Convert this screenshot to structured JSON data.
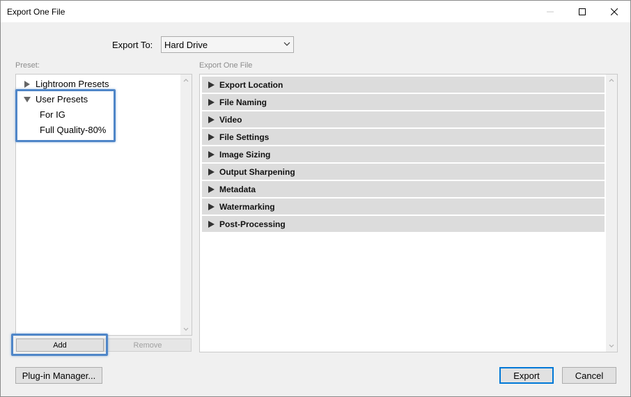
{
  "window": {
    "title": "Export One File"
  },
  "export_to": {
    "label": "Export To:",
    "selected": "Hard Drive"
  },
  "preset": {
    "title": "Preset:",
    "items": [
      {
        "label": "Lightroom Presets",
        "expanded": false
      },
      {
        "label": "User Presets",
        "expanded": true
      },
      {
        "label": "For IG"
      },
      {
        "label": "Full Quality-80%"
      }
    ],
    "add_label": "Add",
    "remove_label": "Remove"
  },
  "export_panel": {
    "title": "Export One File",
    "sections": [
      "Export Location",
      "File Naming",
      "Video",
      "File Settings",
      "Image Sizing",
      "Output Sharpening",
      "Metadata",
      "Watermarking",
      "Post-Processing"
    ]
  },
  "footer": {
    "plugin_label": "Plug-in Manager...",
    "export_label": "Export",
    "cancel_label": "Cancel"
  },
  "colors": {
    "highlight": "#4f86c8",
    "default_button_border": "#0078d7",
    "section_bg": "#dcdcdc"
  }
}
